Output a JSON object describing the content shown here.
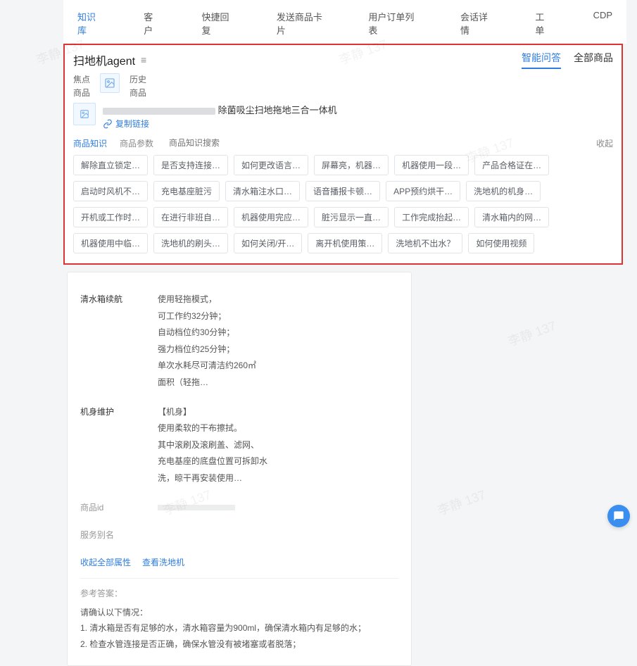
{
  "topnav": {
    "tabs": [
      "知识库",
      "客户",
      "快捷回复",
      "发送商品卡片",
      "用户订单列表",
      "会话详情",
      "工单",
      "CDP"
    ],
    "activeIndex": 0
  },
  "panel": {
    "title": "扫地机agent",
    "rightTabs": {
      "items": [
        "智能问答",
        "全部商品"
      ],
      "activeIndex": 0
    },
    "focus": {
      "col1a": "焦点",
      "col1b": "商品",
      "col2a": "历史",
      "col2b": "商品"
    },
    "product": {
      "name_tail": "除菌吸尘扫地拖地三合一体机",
      "copy_link": "复制链接"
    },
    "subtabs": {
      "items": [
        "商品知识",
        "商品参数"
      ],
      "activeIndex": 0
    },
    "search_placeholder": "商品知识搜索",
    "collapse": "收起",
    "chips": [
      "解除直立锁定…",
      "是否支持连接…",
      "如何更改语言…",
      "屏幕亮，机器…",
      "机器使用一段…",
      "产品合格证在…",
      "启动时风机不…",
      "充电基座脏污",
      "清水箱注水口…",
      "语音播报卡顿…",
      "APP预约烘干…",
      "洗地机的机身…",
      "开机或工作时…",
      "在进行非班自…",
      "机器使用完应…",
      "脏污显示一直…",
      "工作完成抬起…",
      "清水箱内的网…",
      "机器使用中临…",
      "洗地机的刷头…",
      "如何关闭/开…",
      "离开机使用策…",
      "洗地机不出水？",
      "如何使用视频"
    ]
  },
  "detail": {
    "specs": [
      {
        "label": "清水箱续航",
        "lines": [
          "使用轻拖模式，",
          "可工作约32分钟；",
          "自动档位约30分钟；",
          "强力档位约25分钟；",
          "单次水耗尽可清洁约260㎡",
          "面积（轻拖…"
        ]
      },
      {
        "label": "机身维护",
        "lines": [
          "【机身】",
          "使用柔软的干布擦拭。",
          "其中滚刷及滚刷盖、滤网、",
          "充电基座的底盘位置可拆卸水",
          "洗，晾干再安装使用…"
        ]
      },
      {
        "label": "商品id",
        "lines": [
          ""
        ]
      },
      {
        "label": "服务别名",
        "lines": [
          ""
        ]
      }
    ],
    "actions": [
      "收起全部属性",
      "查看洗地机"
    ],
    "answer": {
      "head": "参考答案：",
      "lines": [
        "请确认以下情况：",
        "1. 清水箱是否有足够的水，清水箱容量为900ml，确保清水箱内有足够的水；",
        "2. 检查水管连接是否正确，确保水管没有被堵塞或者脱落；"
      ]
    }
  },
  "watermark": "李静 137"
}
